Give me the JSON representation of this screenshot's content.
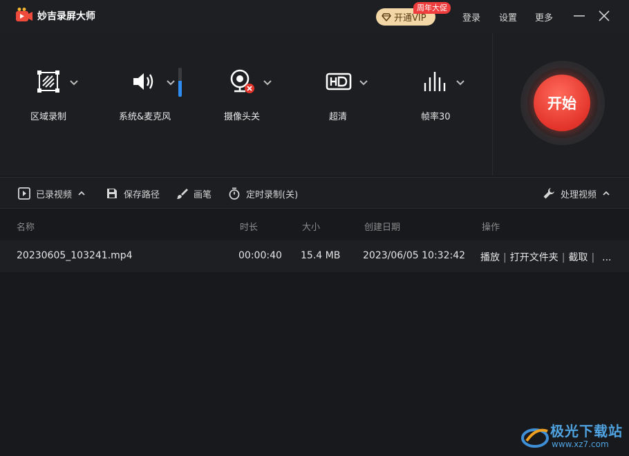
{
  "app": {
    "title": "妙吉录屏大师"
  },
  "header": {
    "vip_label": "开通VIP",
    "promo_badge": "周年大促",
    "login": "登录",
    "settings": "设置",
    "more": "更多"
  },
  "toolbar": {
    "items": [
      {
        "label": "区域录制",
        "icon": "region-record-icon"
      },
      {
        "label": "系统&麦克风",
        "icon": "speaker-icon"
      },
      {
        "label": "摄像头关",
        "icon": "webcam-off-icon"
      },
      {
        "label": "超清",
        "icon": "hd-icon"
      },
      {
        "label": "帧率30",
        "icon": "framerate-icon"
      }
    ],
    "start_label": "开始",
    "volume_level": 0.55
  },
  "subbar": {
    "recorded": "已录视频",
    "save_path": "保存路径",
    "brush": "画笔",
    "timer": "定时录制(关)",
    "process": "处理视频"
  },
  "table": {
    "headers": [
      "名称",
      "时长",
      "大小",
      "创建日期",
      "操作"
    ],
    "rows": [
      {
        "name": "20230605_103241.mp4",
        "duration": "00:00:40",
        "size": "15.4 MB",
        "date": "2023/06/05 10:32:42",
        "actions": [
          "播放",
          "打开文件夹",
          "截取"
        ],
        "more": "..."
      }
    ]
  },
  "watermark": {
    "text": "极光下载站",
    "url": "www.xz7.com"
  },
  "colors": {
    "accent_red": "#e3342b",
    "vip_gold": "#f3d7a6",
    "volume_blue": "#2f8cf0"
  }
}
